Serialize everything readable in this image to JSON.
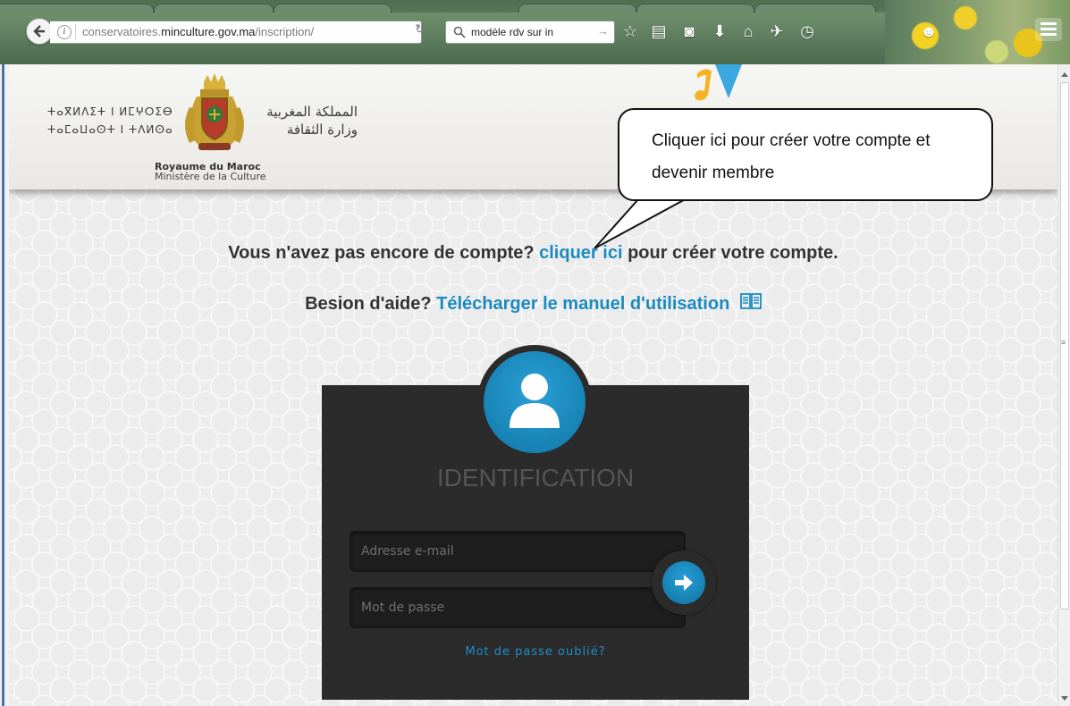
{
  "browser": {
    "url_host_prefix": "conservatoires.",
    "url_host_main": "minculture.gov.ma",
    "url_path": "/inscription/",
    "search_text": "modèle rdv sur in",
    "search_go": "→"
  },
  "header": {
    "tifinagh_line1": "ⵜⴰⴳⵍⴷⵉⵜ ⵏ ⵍⵎⵖⵔⵉⴱ",
    "tifinagh_line2": "ⵜⴰⵎⴰⵡⴰⵙⵜ ⵏ ⵜⴷⵍⵙⴰ",
    "arabic_line1": "المملكة المغربية",
    "arabic_line2": "وزارة الثقافة",
    "royaume": "Royaume du Maroc",
    "ministere": "Ministère de la Culture"
  },
  "callout": {
    "text": "Cliquer ici pour créer votre compte et devenir membre"
  },
  "signup_line": {
    "prefix": "Vous n'avez pas encore de compte?",
    "link": "cliquer ici",
    "suffix": "pour créer votre compte."
  },
  "help_line": {
    "prefix": "Besion d'aide?",
    "link": "Télécharger le manuel d'utilisation"
  },
  "login": {
    "title": "IDENTIFICATION",
    "email_placeholder": "Adresse e-mail",
    "password_placeholder": "Mot de passe",
    "forgot": "Mot de passe oublié?"
  },
  "colors": {
    "accent": "#1b8ac0",
    "panel": "#2b2b2b",
    "chrome": "#5d7d62"
  }
}
